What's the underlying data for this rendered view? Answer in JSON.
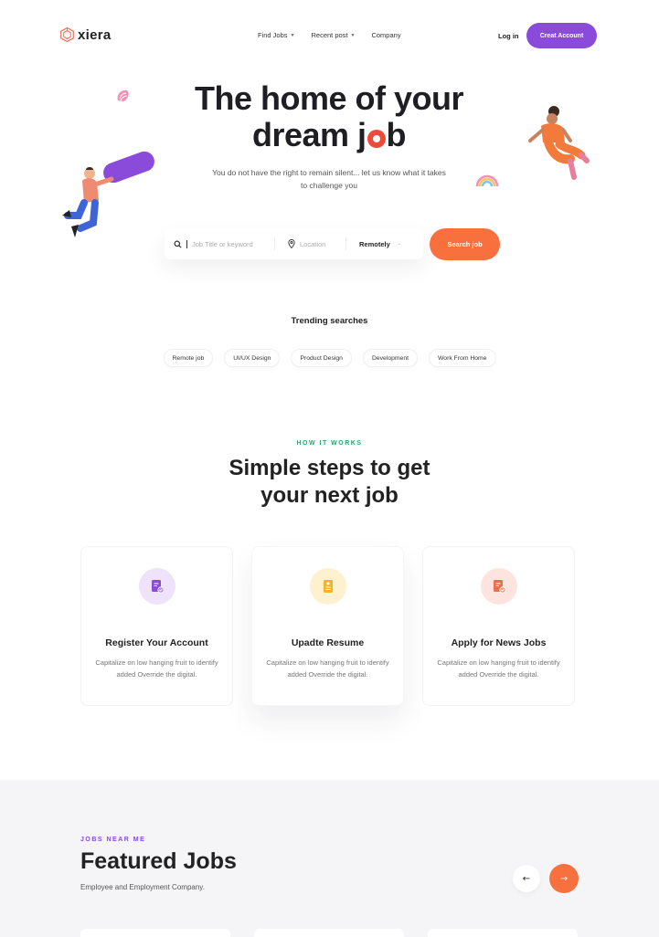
{
  "brand": {
    "name": "xiera",
    "logo_icon": "hexagon-logo-icon"
  },
  "nav": {
    "links": [
      {
        "label": "Find Jobs",
        "has_caret": true
      },
      {
        "label": "Recent post",
        "has_caret": true
      },
      {
        "label": "Company",
        "has_caret": false
      }
    ],
    "login_label": "Log in",
    "create_account_label": "Creat Account"
  },
  "hero": {
    "title_line1": "The home of your",
    "title_line2_pre": "dream j",
    "title_line2_post": "b",
    "subtitle": "You do not have the right to remain silent... let us know what it takes to challenge you"
  },
  "search": {
    "keyword_placeholder": "Job Title or keyword",
    "location_placeholder": "Location",
    "work_type_value": "Remotely",
    "button_label": "Search job"
  },
  "trending": {
    "title": "Trending searches",
    "tags": [
      "Remote job",
      "UI/UX Design",
      "Product Design",
      "Development",
      "Work From Home"
    ]
  },
  "how_it_works": {
    "eyebrow": "HOW IT WORKS",
    "title_line1": "Simple steps to get",
    "title_line2": "your next job",
    "steps": [
      {
        "title": "Register Your Account",
        "description": "Capitalize on low hanging fruit to identify added Override the digital.",
        "icon": "user-document-icon",
        "accent": "#8a4bdb",
        "bg": "#efe3fb"
      },
      {
        "title": "Upadte Resume",
        "description": "Capitalize on low hanging fruit to identify added Override the digital.",
        "icon": "resume-document-icon",
        "accent": "#f2b624",
        "bg": "#fdf1cf"
      },
      {
        "title": "Apply for News Jobs",
        "description": "Capitalize on low hanging fruit to identify added Override the digital.",
        "icon": "apply-document-icon",
        "accent": "#f06b4f",
        "bg": "#fde4de"
      }
    ]
  },
  "featured": {
    "eyebrow": "JOBS NEAR ME",
    "title": "Featured Jobs",
    "subtitle": "Employee and Employment Company.",
    "prev_icon": "arrow-left-icon",
    "next_icon": "arrow-right-icon"
  },
  "colors": {
    "primary_purple": "#8a4bdb",
    "accent_orange": "#f7703d",
    "accent_green": "#2aa36b",
    "text_dark": "#1f1f23",
    "section_bg": "#f5f4f7"
  }
}
